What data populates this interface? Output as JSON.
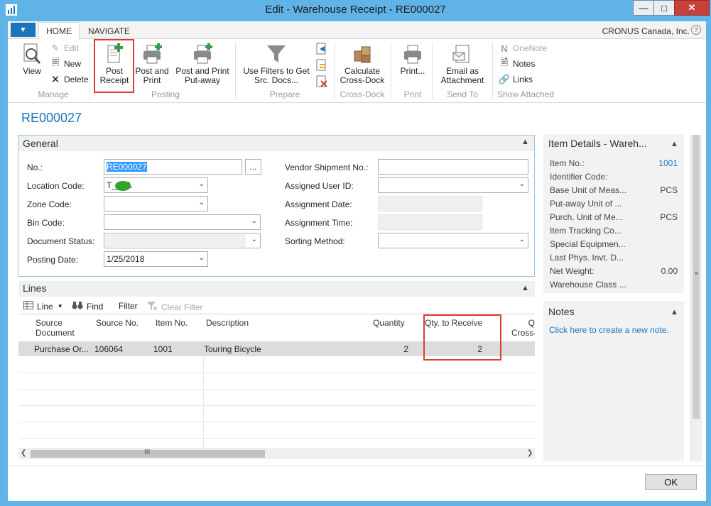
{
  "window": {
    "title": "Edit - Warehouse Receipt - RE000027",
    "minimize_icon": "minimize-icon",
    "maximize_icon": "maximize-icon",
    "close_icon": "close-icon"
  },
  "ribbon_tabs": [
    {
      "label": "HOME",
      "active": true
    },
    {
      "label": "NAVIGATE",
      "active": false
    }
  ],
  "company": "CRONUS Canada, Inc.",
  "help_label": "?",
  "ribbon": {
    "manage": {
      "label": "Manage",
      "view": "View",
      "edit": "Edit",
      "new": "New",
      "delete": "Delete"
    },
    "posting": {
      "label": "Posting",
      "post_receipt": [
        "Post",
        "Receipt"
      ],
      "post_and_print": [
        "Post and",
        "Print"
      ],
      "post_and_print_putaway": [
        "Post and Print",
        "Put-away"
      ]
    },
    "prepare": {
      "label": "Prepare",
      "use_filters": [
        "Use Filters to Get",
        "Src. Docs..."
      ]
    },
    "cross_dock": {
      "label": "Cross-Dock",
      "calculate": [
        "Calculate",
        "Cross-Dock"
      ]
    },
    "print": {
      "label": "Print",
      "print": "Print..."
    },
    "send_to": {
      "label": "Send To",
      "email": [
        "Email as",
        "Attachment"
      ]
    },
    "show_attached": {
      "label": "Show Attached",
      "onenote": "OneNote",
      "notes": "Notes",
      "links": "Links"
    }
  },
  "page_title": "RE000027",
  "general": {
    "header": "General",
    "no_label": "No.:",
    "no_value": "RE000027",
    "location_label": "Location Code:",
    "location_value": "T___A",
    "zone_label": "Zone Code:",
    "zone_value": "",
    "bin_label": "Bin Code:",
    "bin_value": "",
    "doc_status_label": "Document Status:",
    "doc_status_value": "",
    "posting_date_label": "Posting Date:",
    "posting_date_value": "1/25/2018",
    "vendor_ship_label": "Vendor Shipment No.:",
    "vendor_ship_value": "",
    "assigned_user_label": "Assigned User ID:",
    "assigned_user_value": "",
    "assign_date_label": "Assignment Date:",
    "assign_date_value": "",
    "assign_time_label": "Assignment Time:",
    "assign_time_value": "",
    "sorting_label": "Sorting Method:",
    "sorting_value": "",
    "lookup_label": "..."
  },
  "lines": {
    "header": "Lines",
    "toolbar": {
      "line": "Line",
      "find": "Find",
      "filter": "Filter",
      "clear_filter": "Clear Filter"
    },
    "columns": {
      "source_document": [
        "Source",
        "Document"
      ],
      "source_no": "Source No.",
      "item_no": "Item No.",
      "description": "Description",
      "quantity": "Quantity",
      "qty_to_receive": "Qty. to Receive",
      "cross": [
        "Q",
        "Cross-"
      ]
    },
    "rows": [
      {
        "source_document": "Purchase Or...",
        "source_no": "106064",
        "item_no": "1001",
        "description": "Touring Bicycle",
        "quantity": "2",
        "qty_to_receive": "2"
      }
    ],
    "scroll_thumb": "III"
  },
  "item_details": {
    "title": "Item Details - Wareh...",
    "rows": [
      {
        "label": "Item No.:",
        "value": "1001"
      },
      {
        "label": "Identifier Code:",
        "value": ""
      },
      {
        "label": "Base Unit of Meas...",
        "value": "PCS"
      },
      {
        "label": "Put-away Unit of ...",
        "value": ""
      },
      {
        "label": "Purch. Unit of Me...",
        "value": "PCS"
      },
      {
        "label": "Item Tracking Co...",
        "value": ""
      },
      {
        "label": "Special Equipmen...",
        "value": ""
      },
      {
        "label": "Last Phys. Invt. D...",
        "value": ""
      },
      {
        "label": "Net Weight:",
        "value": "0.00"
      },
      {
        "label": "Warehouse Class ...",
        "value": ""
      }
    ]
  },
  "notes": {
    "title": "Notes",
    "link": "Click here to create a new note."
  },
  "ok_label": "OK",
  "colors": {
    "title_bar": "#5fb3e6",
    "accent": "#1b75bc",
    "highlight_box": "#e03c31"
  }
}
